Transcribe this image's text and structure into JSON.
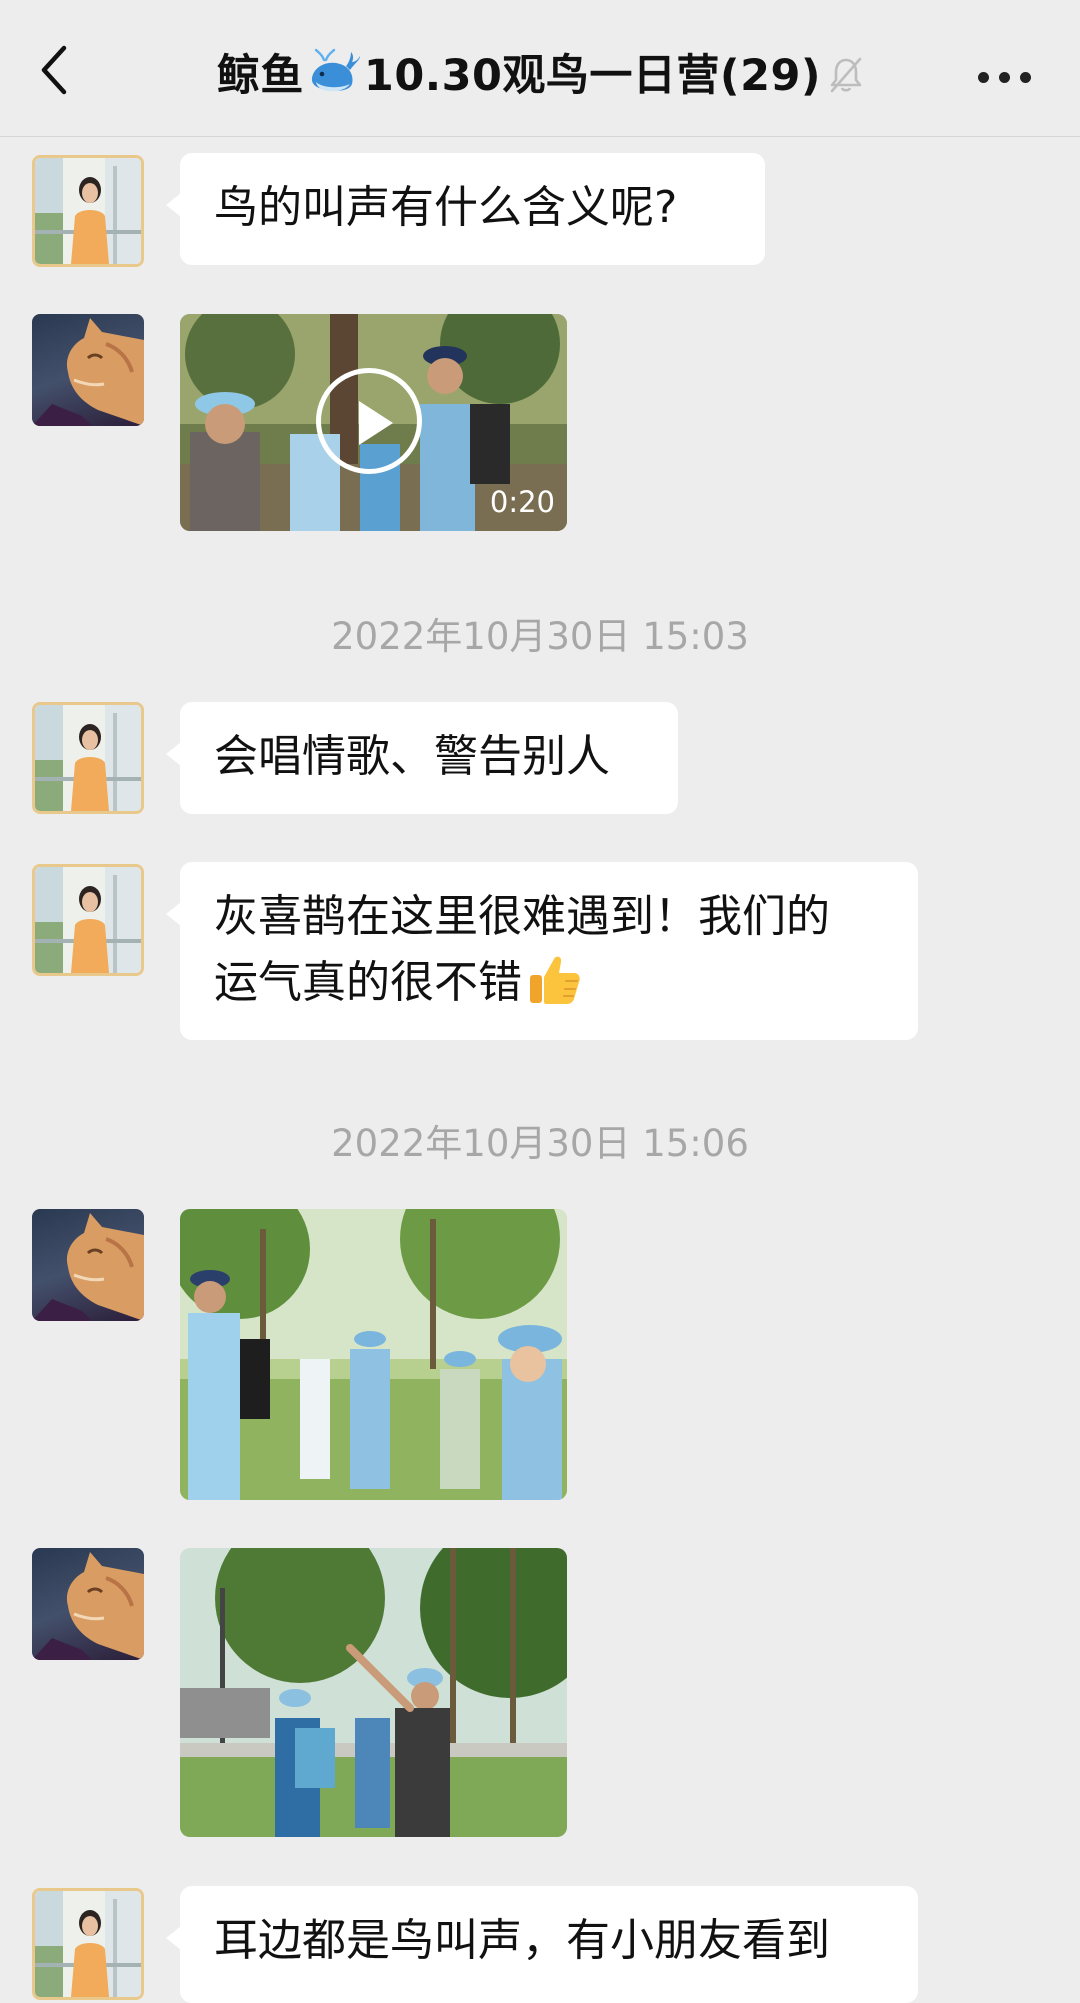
{
  "header": {
    "title_prefix": "鲸鱼",
    "title_suffix": "10.30观鸟一日营(29)"
  },
  "messages": [
    {
      "sender": "girl",
      "text": "鸟的叫声有什么含义呢?"
    },
    {
      "sender": "cat",
      "video_duration": "0:20"
    },
    {
      "timestamp": "2022年10月30日 15:03"
    },
    {
      "sender": "girl",
      "text": "会唱情歌、警告别人"
    },
    {
      "sender": "girl",
      "text_line1": "灰喜鹊在这里很难遇到！我们的",
      "text_line2": "运气真的很不错"
    },
    {
      "timestamp": "2022年10月30日 15:06"
    },
    {
      "sender": "cat",
      "kind": "photo"
    },
    {
      "sender": "cat",
      "kind": "photo"
    },
    {
      "sender": "girl",
      "text": "耳边都是鸟叫声，有小朋友看到"
    }
  ],
  "colors": {
    "background": "#ededed",
    "bubble": "#ffffff",
    "timestamp_text": "#a7a7a7"
  },
  "icons": [
    "back-chevron-icon",
    "whale-emoji-icon",
    "muted-bell-icon",
    "more-icon",
    "play-icon",
    "thumbs-up-emoji-icon"
  ]
}
